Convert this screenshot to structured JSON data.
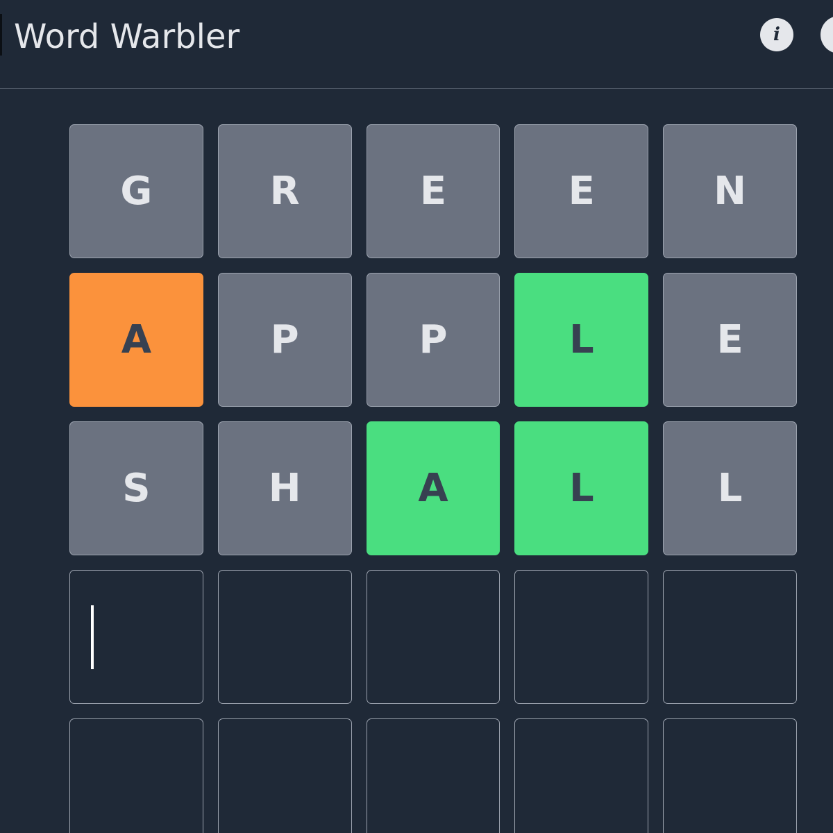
{
  "header": {
    "title": "Word Warbler",
    "info_icon": "info-icon",
    "info_glyph": "i"
  },
  "colors": {
    "background": "#1f2937",
    "absent": "#6b7280",
    "present": "#fb923c",
    "correct": "#4ade80",
    "border": "#9ca3af"
  },
  "board": {
    "rows": [
      {
        "tiles": [
          {
            "letter": "G",
            "state": "absent"
          },
          {
            "letter": "R",
            "state": "absent"
          },
          {
            "letter": "E",
            "state": "absent"
          },
          {
            "letter": "E",
            "state": "absent"
          },
          {
            "letter": "N",
            "state": "absent"
          }
        ]
      },
      {
        "tiles": [
          {
            "letter": "A",
            "state": "present"
          },
          {
            "letter": "P",
            "state": "absent"
          },
          {
            "letter": "P",
            "state": "absent"
          },
          {
            "letter": "L",
            "state": "correct"
          },
          {
            "letter": "E",
            "state": "absent"
          }
        ]
      },
      {
        "tiles": [
          {
            "letter": "S",
            "state": "absent"
          },
          {
            "letter": "H",
            "state": "absent"
          },
          {
            "letter": "A",
            "state": "correct"
          },
          {
            "letter": "L",
            "state": "correct"
          },
          {
            "letter": "L",
            "state": "absent"
          }
        ]
      },
      {
        "tiles": [
          {
            "letter": "",
            "state": "empty"
          },
          {
            "letter": "",
            "state": "empty"
          },
          {
            "letter": "",
            "state": "empty"
          },
          {
            "letter": "",
            "state": "empty"
          },
          {
            "letter": "",
            "state": "empty"
          }
        ]
      },
      {
        "tiles": [
          {
            "letter": "",
            "state": "empty"
          },
          {
            "letter": "",
            "state": "empty"
          },
          {
            "letter": "",
            "state": "empty"
          },
          {
            "letter": "",
            "state": "empty"
          },
          {
            "letter": "",
            "state": "empty"
          }
        ]
      }
    ]
  }
}
